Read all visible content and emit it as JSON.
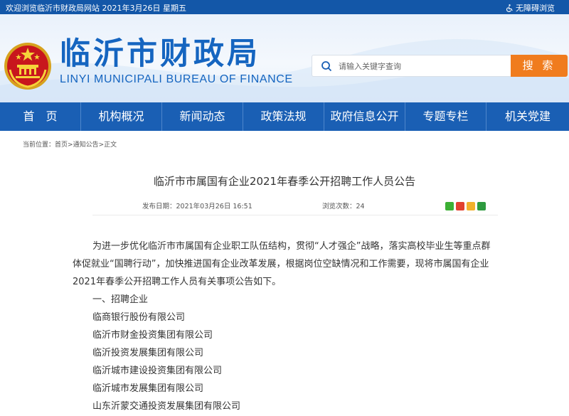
{
  "topbar": {
    "welcome": "欢迎浏览临沂市财政局网站   2021年3月26日  星期五",
    "accessibility": "无障碍浏览"
  },
  "header": {
    "title": "临沂市财政局",
    "subtitle": "LINYI MUNICIPALI BUREAU OF FINANCE",
    "search_placeholder": "请输入关键字查询",
    "search_button": "搜 索"
  },
  "nav": {
    "items": [
      "首　页",
      "机构概况",
      "新闻动态",
      "政策法规",
      "政府信息公开",
      "专题专栏",
      "机关党建"
    ]
  },
  "breadcrumb": {
    "prefix": "当前位置：",
    "home": "首页",
    "sep1": ">",
    "section": "通知公告",
    "sep2": ">",
    "current": "正文"
  },
  "article": {
    "title": "临沂市市属国有企业2021年春季公开招聘工作人员公告",
    "published": "发布日期：2021年03月26日 16:51",
    "views": "浏览次数：24",
    "paragraph": "为进一步优化临沂市市属国有企业职工队伍结构，贯彻“人才强企”战略，落实高校毕业生等重点群体促就业“国聘行动”，加快推进国有企业改革发展，根据岗位空缺情况和工作需要，现将市属国有企业2021年春季公开招聘工作人员有关事项公告如下。",
    "section_heading": "一、招聘企业",
    "companies": [
      "临商银行股份有限公司",
      "临沂市财金投资集团有限公司",
      "临沂投资发展集团有限公司",
      "临沂城市建设投资集团有限公司",
      "临沂城市发展集团有限公司",
      "山东沂蒙交通投资发展集团有限公司"
    ]
  },
  "colors": {
    "primary_blue": "#1a5fb4",
    "title_blue": "#1565c0",
    "search_orange": "#f07c1e"
  },
  "icons": {
    "emblem": "national-emblem-icon",
    "search": "search-icon",
    "accessibility": "wheelchair-icon",
    "share": [
      "wechat-icon",
      "weibo-icon",
      "qzone-icon",
      "douban-icon"
    ]
  }
}
